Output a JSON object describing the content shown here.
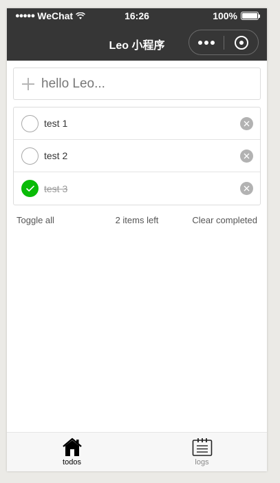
{
  "status_bar": {
    "carrier": "WeChat",
    "time": "16:26",
    "battery": "100%"
  },
  "nav": {
    "title": "Leo 小程序"
  },
  "new_todo": {
    "placeholder": "hello Leo..."
  },
  "todos": [
    {
      "label": "test 1",
      "completed": false
    },
    {
      "label": "test 2",
      "completed": false
    },
    {
      "label": "test 3",
      "completed": true
    }
  ],
  "footer": {
    "toggle_all": "Toggle all",
    "items_left": "2 items left",
    "clear_completed": "Clear completed"
  },
  "tabbar": {
    "tabs": [
      {
        "label": "todos",
        "icon": "home-icon",
        "active": true
      },
      {
        "label": "logs",
        "icon": "notepad-icon",
        "active": false
      }
    ]
  },
  "colors": {
    "nav_bg": "#363636",
    "check_green": "#09bb07",
    "remove_gray": "#b2b2b2"
  }
}
